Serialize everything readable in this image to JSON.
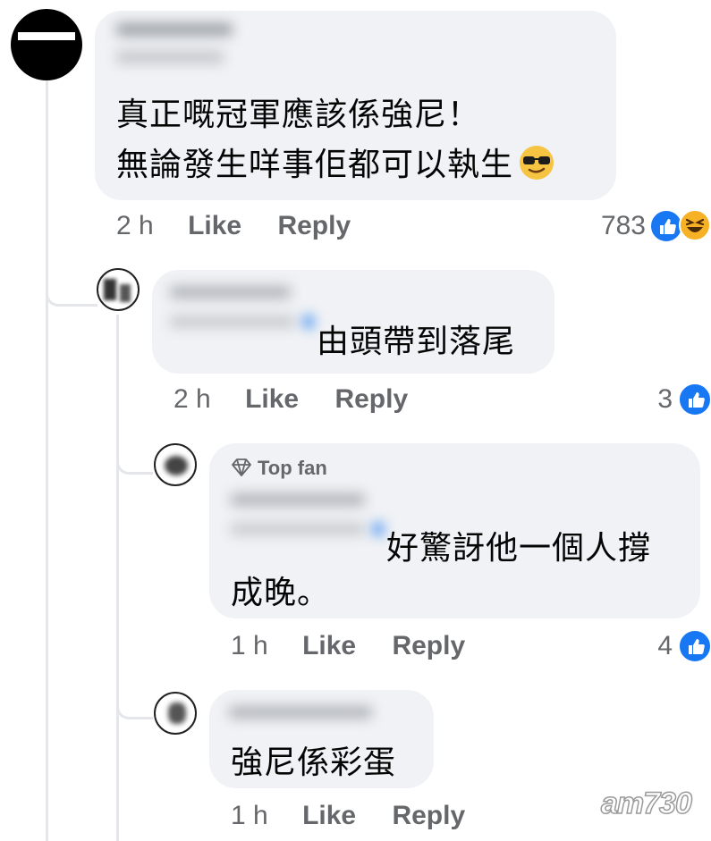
{
  "comments": [
    {
      "text_lines": [
        "真正嘅冠軍應該係強尼！",
        "無論發生咩事佢都可以執生"
      ],
      "emoji": "sunglasses-emoji",
      "time": "2 h",
      "like_label": "Like",
      "reply_label": "Reply",
      "reaction_count": "783",
      "reactions": [
        "like-icon",
        "haha-icon"
      ]
    },
    {
      "text": "由頭帶到落尾",
      "time": "2 h",
      "like_label": "Like",
      "reply_label": "Reply",
      "reaction_count": "3",
      "reactions": [
        "like-icon"
      ]
    },
    {
      "badge": "Top fan",
      "text_lines": [
        "好驚訝他一個人撐",
        "成晚。"
      ],
      "time": "1 h",
      "like_label": "Like",
      "reply_label": "Reply",
      "reaction_count": "4",
      "reactions": [
        "like-icon"
      ]
    },
    {
      "text": "強尼係彩蛋",
      "time": "1 h",
      "like_label": "Like",
      "reply_label": "Reply"
    }
  ],
  "watermark": "am730",
  "colors": {
    "bubble": "#f0f2f5",
    "meta_text": "#65676b",
    "like_blue": "#1877f2",
    "haha_yellow": "#f7b125"
  }
}
